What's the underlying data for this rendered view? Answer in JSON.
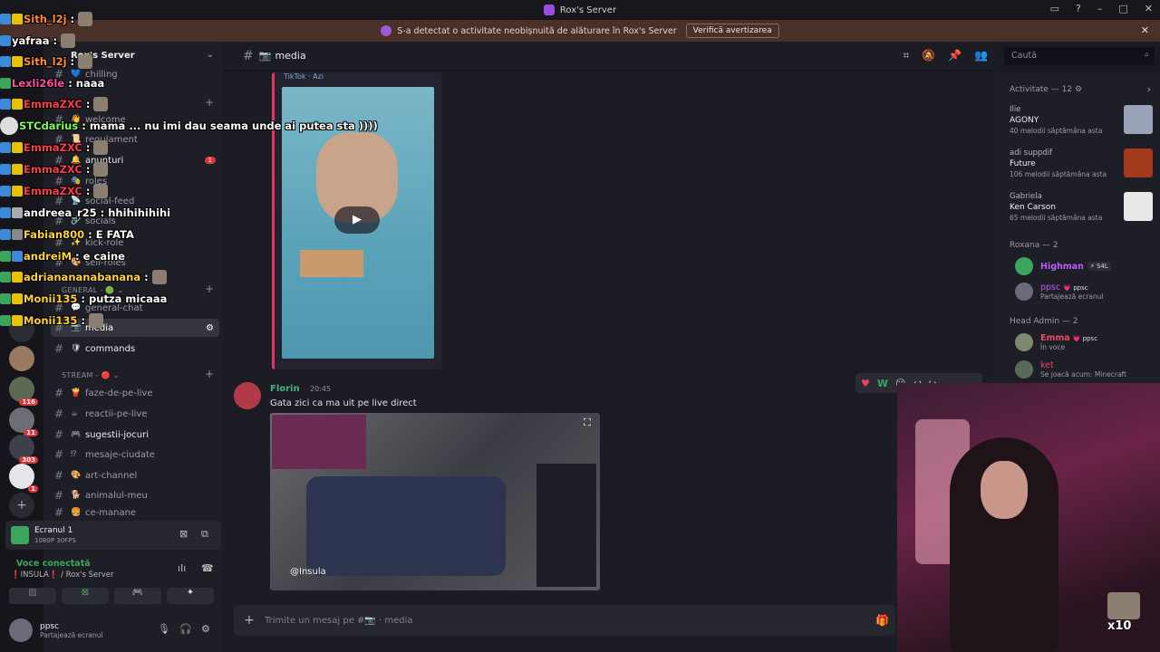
{
  "window": {
    "title": "Rox's Server"
  },
  "banner": {
    "text": "S-a detectat o activitate neobișnuită de alăturare în Rox's Server",
    "button": "Verifică avertizarea"
  },
  "server_list": {
    "badges": [
      "116",
      "11",
      "303",
      "1"
    ]
  },
  "sidebar": {
    "server_name": "Rox's Server",
    "channels": [
      {
        "name": "chilling",
        "emoji": "💙"
      },
      {
        "name": "welcome",
        "emoji": "👋"
      },
      {
        "name": "regulament",
        "emoji": "📜"
      },
      {
        "name": "anunturi",
        "emoji": "🔔",
        "badge": "1"
      },
      {
        "name": "roles",
        "emoji": "🎭"
      },
      {
        "name": "social-feed",
        "emoji": "📡"
      },
      {
        "name": "socials",
        "emoji": "🔗"
      },
      {
        "name": "kick-role",
        "emoji": "✨"
      },
      {
        "name": "self-roles",
        "emoji": "🎨"
      }
    ],
    "category_general": "GENERAL - 🟢 ⌄",
    "general_channels": [
      {
        "name": "general-chat",
        "emoji": "💬"
      },
      {
        "name": "media",
        "emoji": "📷",
        "active": true
      },
      {
        "name": "commands",
        "emoji": "🛡"
      }
    ],
    "category_stream": "STREAM - 🔴 ⌄",
    "stream_channels": [
      {
        "name": "faze-de-pe-live",
        "emoji": "🍟"
      },
      {
        "name": "reactii-pe-live",
        "emoji": "☕"
      },
      {
        "name": "sugestii-jocuri",
        "emoji": "🎮"
      },
      {
        "name": "mesaje-ciudate",
        "emoji": "⁉"
      },
      {
        "name": "art-channel",
        "emoji": "🎨"
      },
      {
        "name": "animalul-meu",
        "emoji": "🐕"
      },
      {
        "name": "ce-manane",
        "emoji": "🍔"
      }
    ]
  },
  "voice": {
    "screen_name": "Ecranul 1",
    "screen_quality": "1080P 30FPS",
    "status": "Voce conectată",
    "location": "❗INSULA❗ / Rox's Server"
  },
  "user": {
    "name": "ppsc",
    "status": "Partajează ecranul"
  },
  "header": {
    "channel": "media",
    "search_placeholder": "Caută"
  },
  "tiktok": {
    "label": "TikTok · Azi"
  },
  "message": {
    "author": "Florin",
    "time": "20:45",
    "text": "Gata zici ca ma uit pe live direct",
    "watermark": "@Insula"
  },
  "composer": {
    "placeholder": "Trimite un mesaj pe #📷 · media"
  },
  "activity": {
    "title": "Activitate — 12 ⚙",
    "items": [
      {
        "user": "Ilie",
        "track": "AGONY",
        "meta": "40 melodii săptămâna asta",
        "color": "#9aa4b8"
      },
      {
        "user": "adi suppdif",
        "track": "Future",
        "meta": "106 melodii săptămâna asta",
        "color": "#a23a1c"
      },
      {
        "user": "Gabriela",
        "track": "Ken Carson",
        "meta": "65 melodii săptămâna asta",
        "color": "#e8e8e8"
      }
    ]
  },
  "members": {
    "group1": "Roxana — 2",
    "group1_members": [
      {
        "name": "Highman",
        "tag": "⚡ S4L",
        "color": "#b95cf5",
        "sub": ""
      },
      {
        "name": "ppsc",
        "tag": "💗 ppsc",
        "color": "#b95cf5",
        "sub": "Partajează ecranul"
      }
    ],
    "group2": "Head Admin — 2",
    "group2_members": [
      {
        "name": "Emma",
        "tag": "💗 ppsc",
        "color": "#e84a5f",
        "sub": "În voce"
      },
      {
        "name": "ket",
        "tag": "",
        "color": "#e84a5f",
        "sub": "Se joacă acum: Minecraft"
      }
    ]
  },
  "overlay_chat": [
    {
      "user": "Sith_l2j",
      "text": "",
      "color": "#ff8c3a",
      "emote": true
    },
    {
      "user": "yafraa",
      "text": "",
      "color": "#ffffff",
      "emote": true
    },
    {
      "user": "Sith_l2j",
      "text": "",
      "color": "#ff8c3a",
      "emote": true
    },
    {
      "user": "Lexli26le",
      "text": "naaa",
      "color": "#ff4fa0",
      "emote": false
    },
    {
      "user": "EmmaZXC",
      "text": "",
      "color": "#ff3a4a",
      "emote": true
    },
    {
      "user": "STCdarius",
      "text": "mama ... nu imi dau seama unde ai putea sta ))))",
      "color": "#7dff5a",
      "emote": false
    },
    {
      "user": "EmmaZXC",
      "text": "",
      "color": "#ff3a4a",
      "emote": true
    },
    {
      "user": "EmmaZXC",
      "text": "",
      "color": "#ff3a4a",
      "emote": true
    },
    {
      "user": "EmmaZXC",
      "text": "",
      "color": "#ff3a4a",
      "emote": true
    },
    {
      "user": "andreea_r25",
      "text": "hhihihihihi",
      "color": "#ffffff",
      "emote": false
    },
    {
      "user": "Fabian800",
      "text": "E FATA",
      "color": "#ffd23a",
      "emote": false
    },
    {
      "user": "andreiM",
      "text": "e caine",
      "color": "#ffd23a",
      "emote": false
    },
    {
      "user": "adrianananabanana",
      "text": "",
      "color": "#ffd23a",
      "emote": true
    },
    {
      "user": "Monii135",
      "text": "putza micaaa",
      "color": "#ffd23a",
      "emote": false
    },
    {
      "user": "Monii135",
      "text": "",
      "color": "#ffd23a",
      "emote": true
    }
  ],
  "overlay_badge": "x10"
}
